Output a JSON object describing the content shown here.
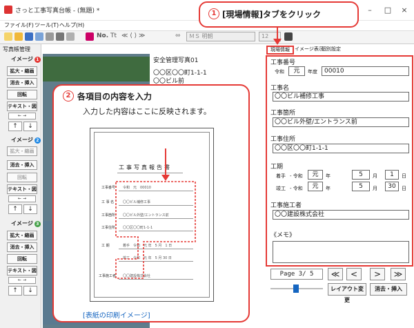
{
  "window": {
    "title": "さっと工事写真台帳 - (無題) *",
    "minimize": "–",
    "maximize": "□",
    "close": "×"
  },
  "menu": [
    "ファイル(F)",
    "ツール(T)",
    "ヘルプ(H)"
  ],
  "toolbar": {
    "no": "No.",
    "t": "Tt",
    "font": "ＭＳ 明朝",
    "size": "12"
  },
  "left": {
    "header": "写真帳管理",
    "images": [
      {
        "label": "イメージ",
        "num": "1",
        "color": "#e53935"
      },
      {
        "label": "イメージ",
        "num": "2",
        "color": "#1e88e5"
      },
      {
        "label": "イメージ",
        "num": "3",
        "color": "#43a047"
      }
    ],
    "buttons": {
      "zoom": "拡大・縮画",
      "delete": "消去・挿入",
      "rotate": "回転",
      "text": "テキスト・図"
    },
    "up": "↑",
    "down": "↓",
    "lr": "← →"
  },
  "captions": {
    "c1": "安全管理写真01",
    "c2": "〇〇区〇〇町1-1-1",
    "c3": "〇〇ビル前"
  },
  "callout1": {
    "num": "1",
    "text": "[現場情報]タブをクリック"
  },
  "callout2": {
    "num": "2",
    "title": "各項目の内容を入力",
    "sub": "入力した内容はここに反映されます。",
    "print_caption": "[表紙の印刷イメージ]"
  },
  "sheet": {
    "title": "工事写真報告書",
    "rows": [
      "工事番号",
      "工 事 名",
      "工事箇所",
      "工事住所",
      "工 期",
      "工事施工者"
    ],
    "values": [
      "令和　元　00010",
      "〇〇ビル補修工事",
      "〇〇ビル外壁/エントランス前",
      "〇〇区〇〇町1-1-1",
      "着手　令和　元 年　5 月　1 日",
      "竣工　令和　元 年　5 月 30 日",
      "〇〇建設株式会社"
    ]
  },
  "tabs": {
    "site": "現場情報",
    "image": "イメージ表示",
    "other": "個別設定"
  },
  "form": {
    "no_label": "工事番号",
    "era": "令和",
    "era_year": "元",
    "year_suffix": "年度",
    "number": "00010",
    "name_label": "工事名",
    "name": "〇〇ビル補修工事",
    "place_label": "工事箇所",
    "place": "〇〇ビル外壁/エントランス前",
    "addr_label": "工事住所",
    "addr": "〇〇区〇〇町1-1-1",
    "period_label": "工期",
    "start_label": "着手",
    "end_label": "竣工",
    "dash_era": "- 令和",
    "start": {
      "y": "元",
      "m": "5",
      "d": "1"
    },
    "end": {
      "y": "元",
      "m": "5",
      "d": "30"
    },
    "u_year": "年",
    "u_month": "月",
    "u_day": "日",
    "contractor_label": "工事施工者",
    "contractor": "〇〇建設株式会社",
    "memo_label": "《メモ》"
  },
  "nav": {
    "page": "Page 3/ 5",
    "first": "≪",
    "prev": "<",
    "next": ">",
    "last": "≫",
    "layout": "レイアウト変更",
    "delete_insert": "消去・挿入"
  }
}
